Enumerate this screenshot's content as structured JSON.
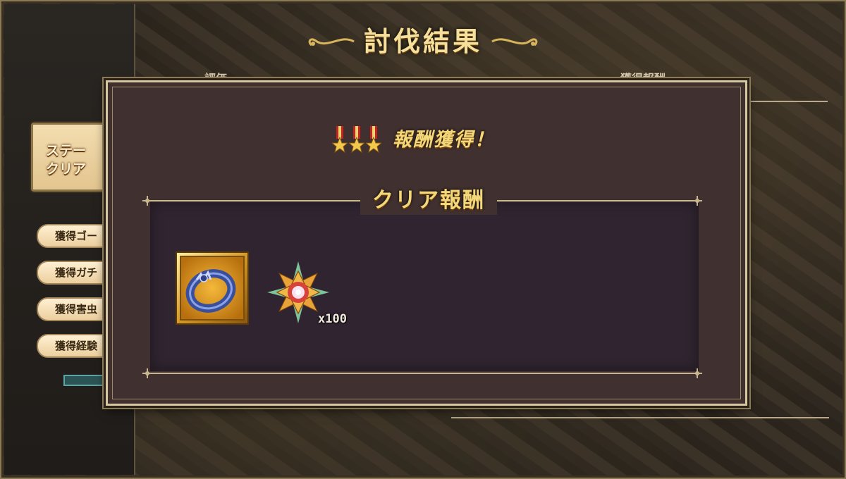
{
  "screen": {
    "title": "討伐結果",
    "stage_clear_label": "ステー\nクリア",
    "stats": [
      {
        "label": "獲得ゴー"
      },
      {
        "label": "獲得ガチ"
      },
      {
        "label": "獲得害虫"
      },
      {
        "label": "獲得経験"
      }
    ],
    "bg_left_heading": "評価",
    "bg_right_heading": "獲得報酬"
  },
  "modal": {
    "header": "報酬獲得！",
    "medal_count": 3,
    "section_title": "クリア報酬",
    "items": [
      {
        "icon": "ring-icon",
        "quantity": ""
      },
      {
        "icon": "crystal-flower-icon",
        "quantity": "x100"
      }
    ]
  },
  "colors": {
    "gold_text": "#f3d87a",
    "modal_bg": "#40302f",
    "panel_bg": "#2f2430",
    "frame": "#d7c7a0"
  }
}
